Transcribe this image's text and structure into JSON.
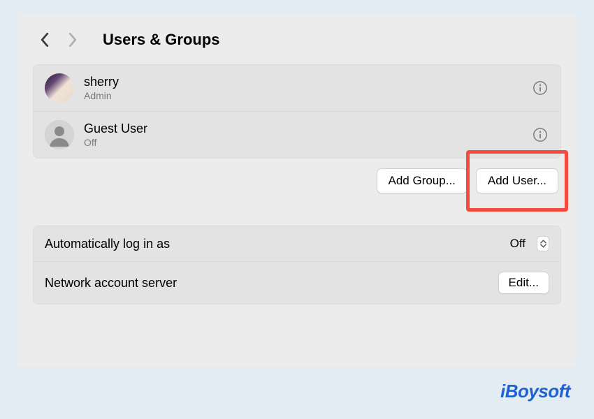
{
  "header": {
    "title": "Users & Groups"
  },
  "users": [
    {
      "name": "sherry",
      "role": "Admin",
      "avatar": "photo"
    },
    {
      "name": "Guest User",
      "role": "Off",
      "avatar": "placeholder"
    }
  ],
  "buttons": {
    "add_group": "Add Group...",
    "add_user": "Add User..."
  },
  "settings": {
    "auto_login": {
      "label": "Automatically log in as",
      "value": "Off"
    },
    "network_server": {
      "label": "Network account server",
      "button": "Edit..."
    }
  },
  "watermark": "iBoysoft"
}
